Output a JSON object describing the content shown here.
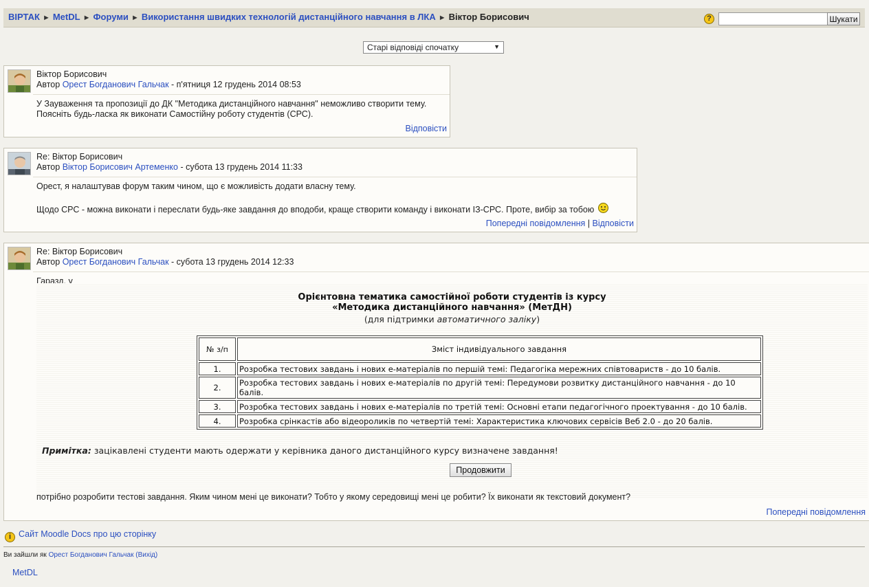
{
  "navbar": {
    "crumbs": [
      "ВІРТАК",
      "MetDL",
      "Форуми",
      "Використання швидких технологій дистанційного навчання в ЛКА"
    ],
    "current": "Віктор Борисович",
    "separator": "►",
    "help_glyph": "?",
    "search": {
      "value": "",
      "button": "Шукати"
    }
  },
  "sort": {
    "selected": "Старі відповіді спочатку",
    "arrow": "▼"
  },
  "posts": [
    {
      "subject": "Віктор Борисович",
      "by_prefix": "Автор",
      "author": "Орест Богданович Гальчак",
      "date": "- п'ятниця 12 грудень 2014 08:53",
      "lines": [
        "У Зауваження та пропозиції до ДК \"Методика дистанційного навчання\" неможливо створити тему.",
        "Поясніть будь-ласка як виконати Самостійну роботу студентів (СРС)."
      ],
      "cmd_reply": "Відповісти"
    },
    {
      "subject": "Re: Віктор Борисович",
      "by_prefix": "Автор",
      "author": "Віктор Борисович Артеменко",
      "date": "- субота 13 грудень 2014 11:33",
      "lines": [
        "Орест, я налаштував форум таким чином, що є можливість додати власну тему.",
        "Щодо СРС - можна виконати і переслати будь-яке завдання до вподоби, краще створити команду і виконати ІЗ-СРС. Проте, вибір за тобою"
      ],
      "cmd_parent": "Попередні повідомлення",
      "cmd_sep": "|",
      "cmd_reply": "Відповісти"
    },
    {
      "subject": "Re: Віктор Борисович",
      "by_prefix": "Автор",
      "author": "Орест Богданович Гальчак",
      "date": "- субота 13 грудень 2014 12:33",
      "intro": "Гаразд, у",
      "doc": {
        "title1": "Орієнтовна тематика самостійної роботи студентів із курсу",
        "title2": "«Методика дистанційного навчання» (МетДН)",
        "sub_open": "(для підтримки ",
        "sub_italic": "автоматичного заліку",
        "sub_close": ")",
        "col_num": "№ з/п",
        "col_task": "Зміст індивідуального завдання",
        "rows": [
          {
            "n": "1.",
            "text": "Розробка тестових завдань і нових е-матеріалів по першій темі: Педагогіка мережних співтовариств - до 10 балів."
          },
          {
            "n": "2.",
            "text": "Розробка тестових завдань і нових е-матеріалів по другій темі: Передумови розвитку дистанційного навчання - до 10 балів."
          },
          {
            "n": "3.",
            "text": "Розробка тестових завдань і нових е-матеріалів по третій темі: Основні етапи педагогічного проектування - до 10 балів."
          },
          {
            "n": "4.",
            "text": "Розробка срінкастів або відеороликів по четвертій темі: Характеристика ключових сервісів Веб 2.0 - до 20 балів."
          }
        ],
        "note_label": "Примітка:",
        "note_text": " зацікавлені студенти мають одержати у керівника даного дистанційного курсу визначене завдання!",
        "continue": "Продовжити"
      },
      "outro": "потрібно розробити тестові завдання. Яким чином мені це виконати? Тобто у якому середовищі мені це робити? Їх виконати як текстовий документ?",
      "cmd_parent": "Попередні повідомлення"
    }
  ],
  "footer": {
    "info_glyph": "i",
    "moodle_docs": "Сайт Moodle Docs про цю сторінку",
    "login_prefix": "Ви зайшли як",
    "login_user": "Орест Богданович Гальчак",
    "logout": "(Вихід)",
    "home": "MetDL"
  },
  "colors": {
    "link": "#2b4fc0",
    "navbar_bg": "#e0ddd0",
    "page_bg": "#f2f1ec",
    "post_bg": "#fdfcf9"
  }
}
